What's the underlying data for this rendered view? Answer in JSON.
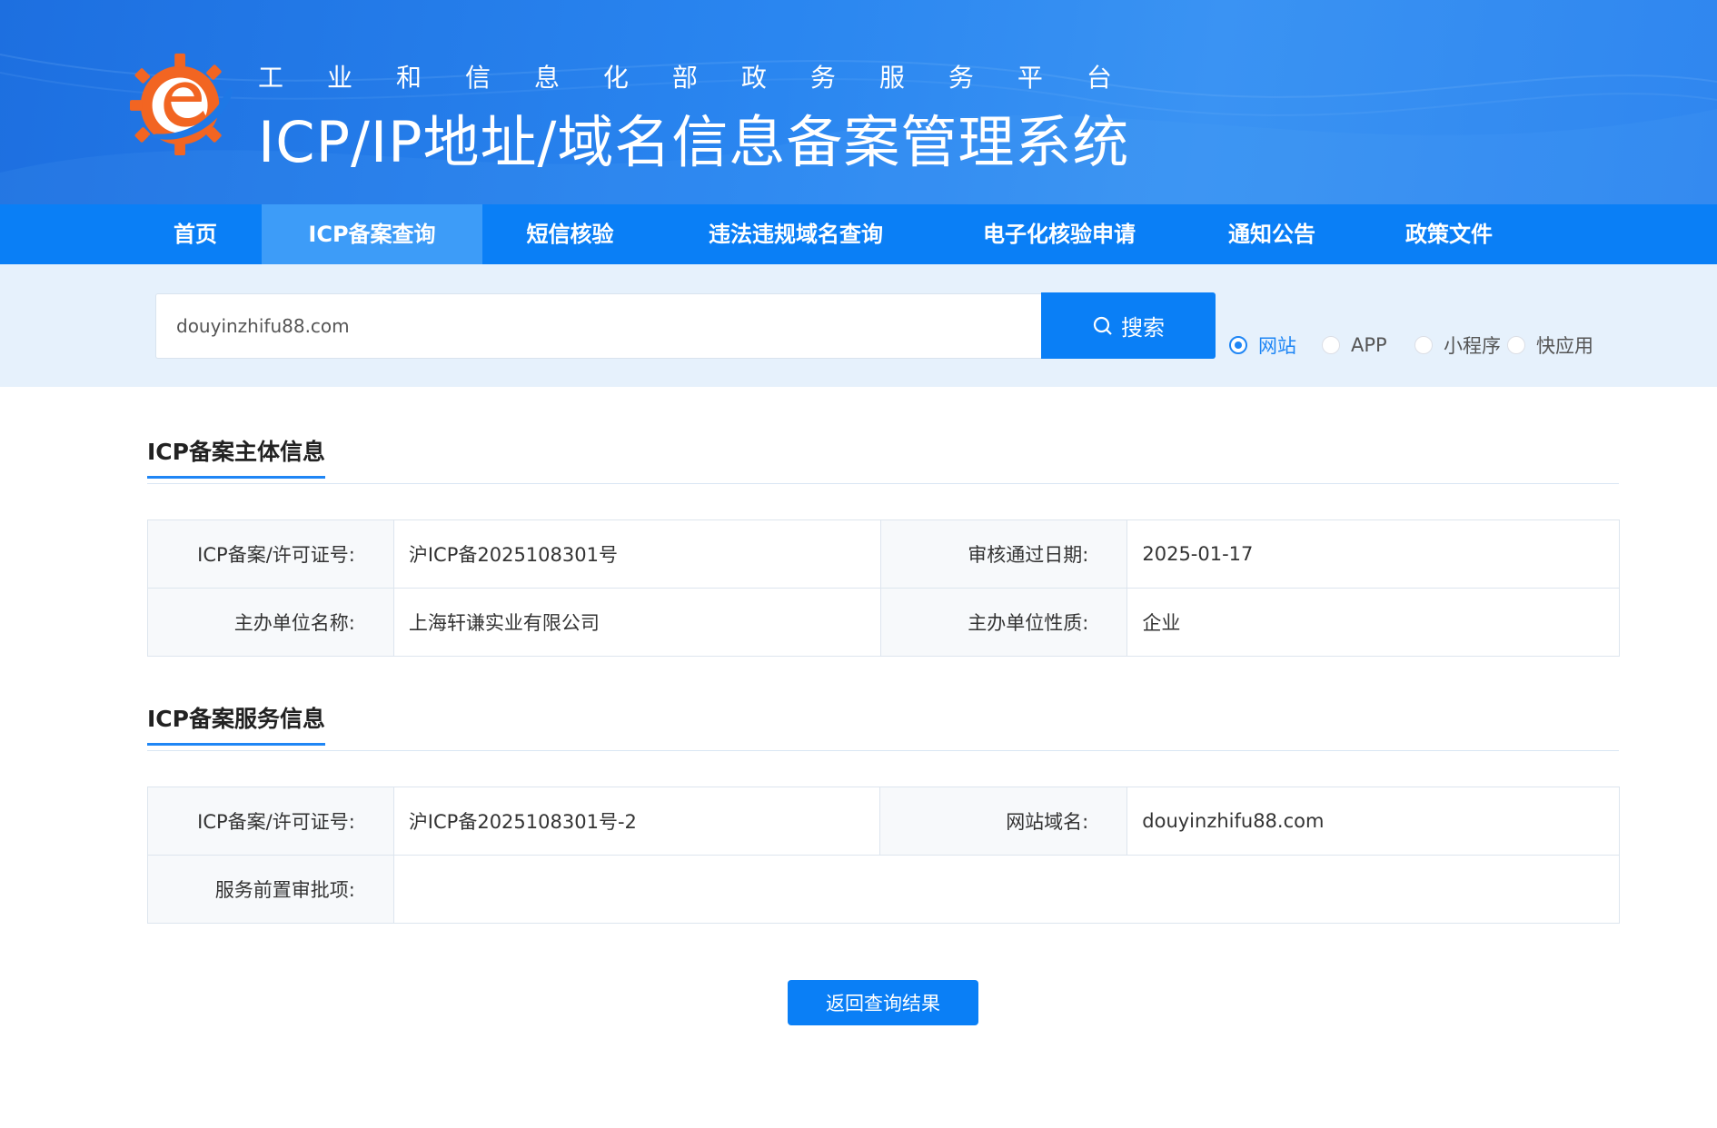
{
  "header": {
    "subtitle_chars": [
      "工",
      "业",
      "和",
      "信",
      "息",
      "化",
      "部",
      "政",
      "务",
      "服",
      "务",
      "平",
      "台"
    ],
    "title": "ICP/IP地址/域名信息备案管理系统"
  },
  "nav": {
    "items": [
      {
        "label": "首页"
      },
      {
        "label": "ICP备案查询"
      },
      {
        "label": "短信核验"
      },
      {
        "label": "违法违规域名查询"
      },
      {
        "label": "电子化核验申请"
      },
      {
        "label": "通知公告"
      },
      {
        "label": "政策文件"
      }
    ],
    "active": "ICP备案查询"
  },
  "search": {
    "value": "douyinzhifu88.com",
    "button_label": "搜索",
    "types": [
      {
        "label": "网站",
        "checked": true
      },
      {
        "label": "APP",
        "checked": false
      },
      {
        "label": "小程序",
        "checked": false
      },
      {
        "label": "快应用",
        "checked": false
      }
    ]
  },
  "subject_info": {
    "title": "ICP备案主体信息",
    "rows": [
      {
        "label1": "ICP备案/许可证号:",
        "value1": "沪ICP备2025108301号",
        "label2": "审核通过日期:",
        "value2": "2025-01-17"
      },
      {
        "label1": "主办单位名称:",
        "value1": "上海轩谦实业有限公司",
        "label2": "主办单位性质:",
        "value2": "企业"
      }
    ]
  },
  "service_info": {
    "title": "ICP备案服务信息",
    "license_label": "ICP备案/许可证号:",
    "license_value": "沪ICP备2025108301号-2",
    "domain_label": "网站域名:",
    "domain_value": "douyinzhifu88.com",
    "preapproval_label": "服务前置审批项:",
    "preapproval_value": ""
  },
  "back_button_label": "返回查询结果",
  "colors": {
    "nav_bg": "#0a7ff6",
    "nav_active": "#3d9cf8",
    "accent": "#1f86f5",
    "search_strip": "#e6f1fc",
    "logo_orange": "#f26522"
  }
}
